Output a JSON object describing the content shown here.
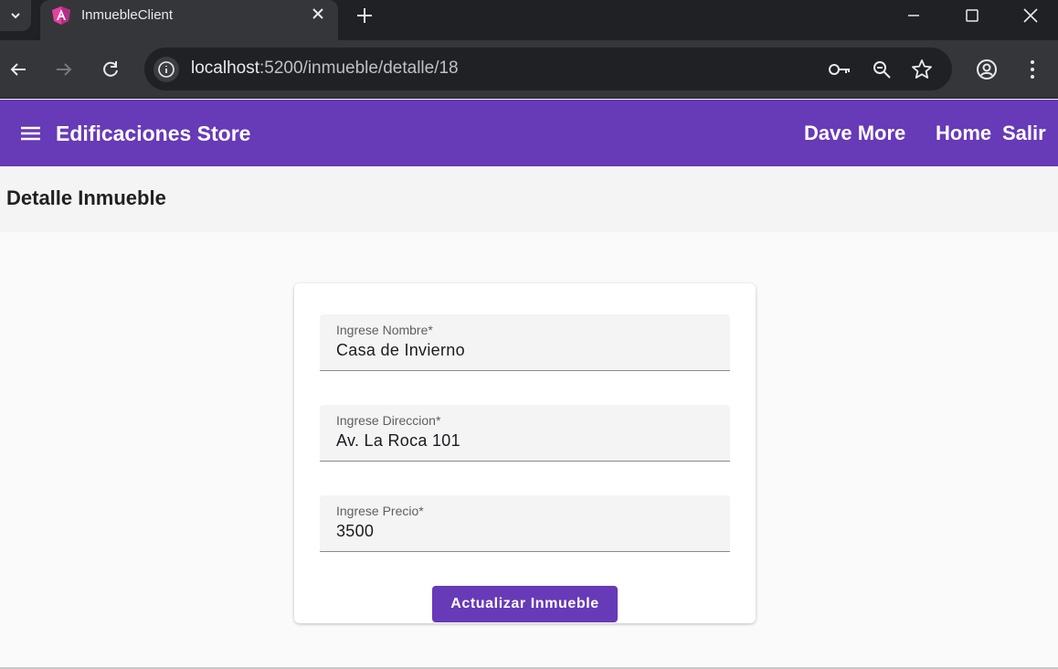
{
  "browser": {
    "tab_title": "InmuebleClient",
    "url_host": "localhost",
    "url_path": ":5200/inmueble/detalle/18"
  },
  "app": {
    "title": "Edificaciones Store",
    "nav": {
      "user": "Dave More",
      "home": "Home",
      "exit": "Salir"
    }
  },
  "page": {
    "title": "Detalle Inmueble"
  },
  "form": {
    "name_label": "Ingrese Nombre*",
    "name_value": "Casa de Invierno",
    "address_label": "Ingrese Direccion*",
    "address_value": "Av. La Roca 101",
    "price_label": "Ingrese Precio*",
    "price_value": "3500",
    "submit_label": "Actualizar Inmueble"
  },
  "colors": {
    "primary": "#673ab7",
    "chrome_dark": "#202124",
    "chrome_toolbar": "#35363a"
  }
}
